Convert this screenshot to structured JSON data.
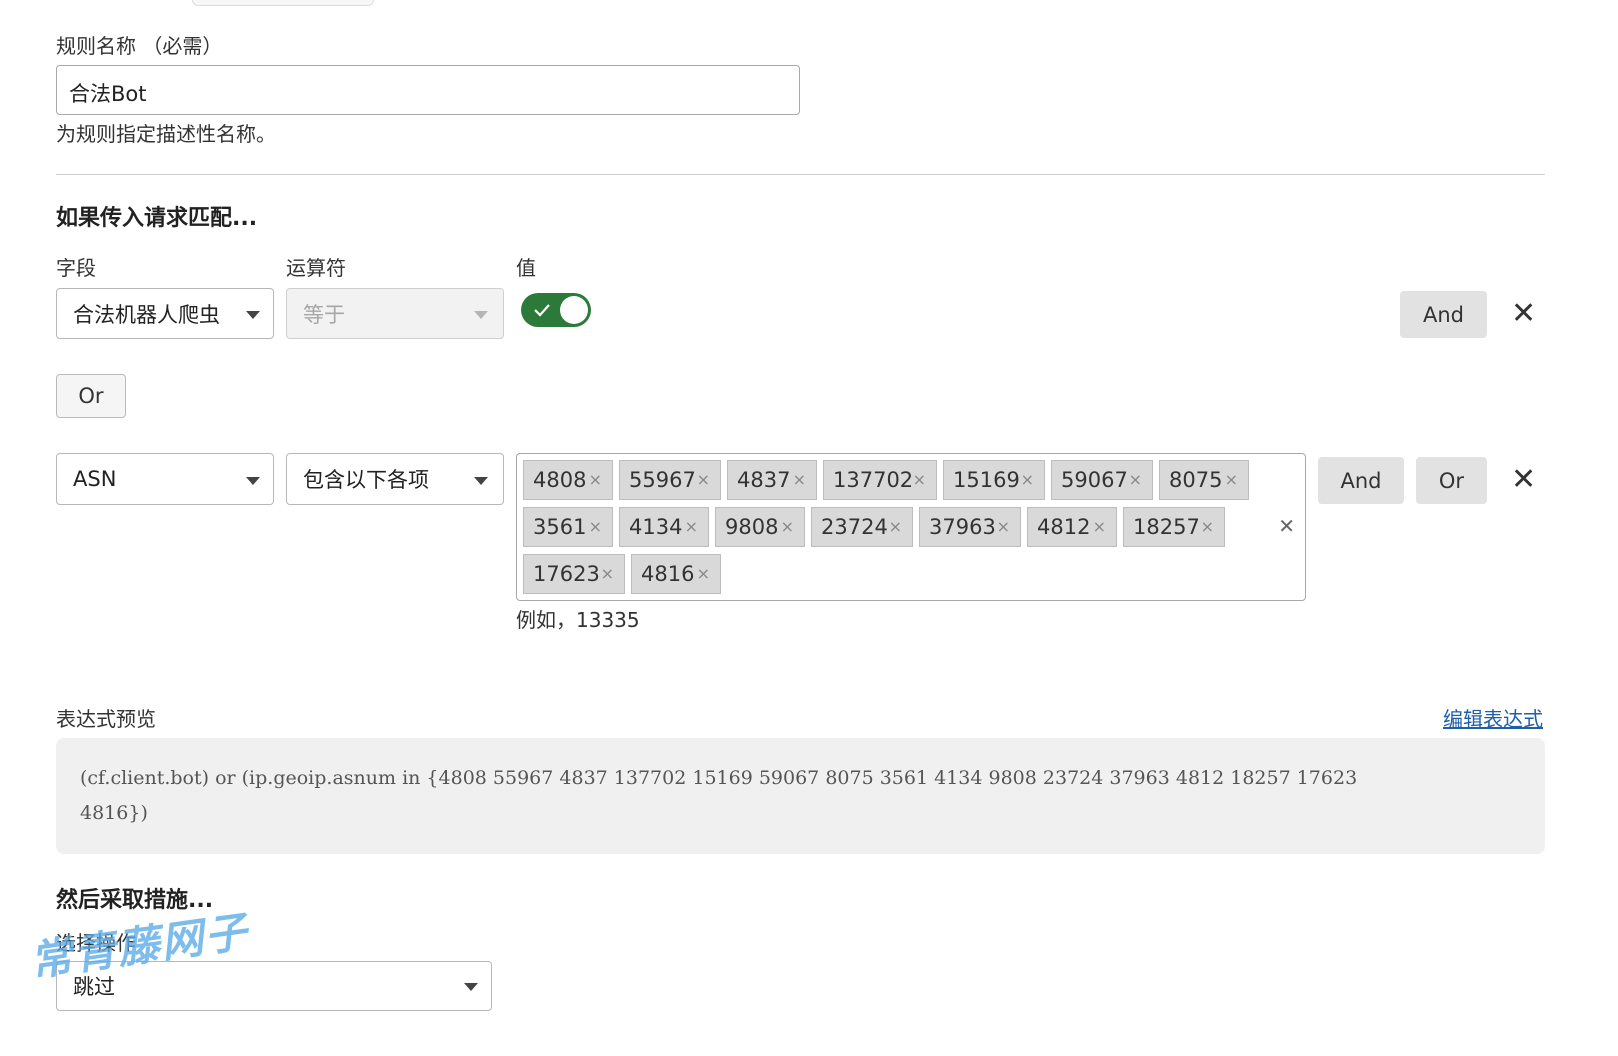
{
  "rule_name": {
    "label": "规则名称 （必需）",
    "value": "合法Bot",
    "help": "为规则指定描述性名称。"
  },
  "match_section": {
    "title": "如果传入请求匹配...",
    "col_field": "字段",
    "col_operator": "运算符",
    "col_value": "值",
    "row1": {
      "field": "合法机器人爬虫",
      "operator": "等于",
      "toggle_on": true,
      "and_label": "And"
    },
    "or_label": "Or",
    "row2": {
      "field": "ASN",
      "operator": "包含以下各项",
      "tags": [
        "4808",
        "55967",
        "4837",
        "137702",
        "15169",
        "59067",
        "8075",
        "3561",
        "4134",
        "9808",
        "23724",
        "37963",
        "4812",
        "18257",
        "17623",
        "4816"
      ],
      "help": "例如，13335",
      "and_label": "And",
      "or_label": "Or"
    }
  },
  "expression": {
    "label": "表达式预览",
    "edit_link": "编辑表达式",
    "line1": "(cf.client.bot) or (ip.geoip.asnum in {4808 55967 4837 137702 15169 59067 8075 3561 4134 9808 23724 37963 4812 18257 17623",
    "line2": "4816})"
  },
  "action": {
    "title": "然后采取措施...",
    "label": "选择操作",
    "value": "跳过"
  },
  "watermark": "常青藤网子",
  "colors": {
    "toggle": "#2c7a3a",
    "link": "#1f5fa8",
    "code_bg": "#f0f0f0"
  }
}
